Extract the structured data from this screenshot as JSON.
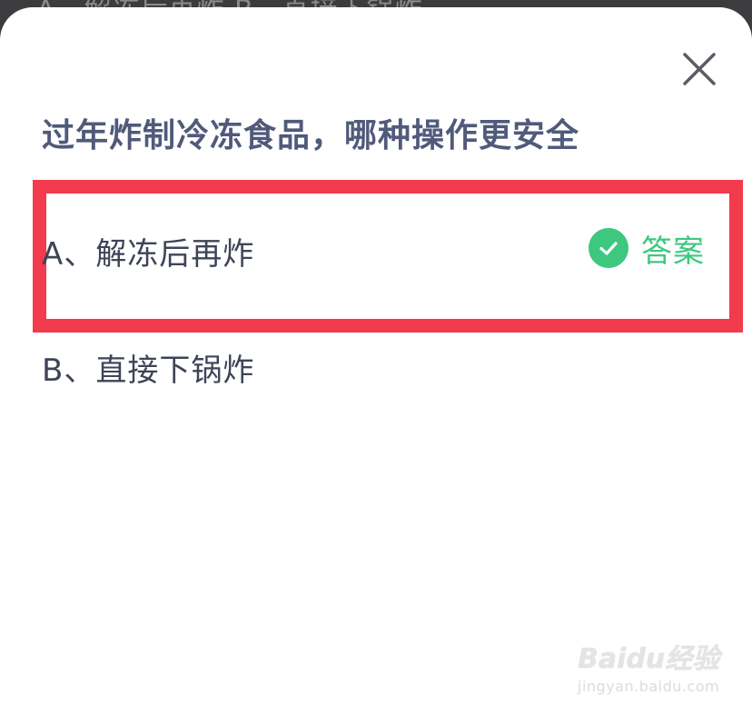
{
  "backdrop": {
    "text": "A、解冻后再炸    B、直接下锅炸"
  },
  "dialog": {
    "question": "过年炸制冷冻食品，哪种操作更安全",
    "options": [
      {
        "label": "A、解冻后再炸",
        "is_answer": true
      },
      {
        "label": "B、直接下锅炸",
        "is_answer": false
      }
    ],
    "answer_label": "答案",
    "close_icon": "close-icon"
  },
  "colors": {
    "question_text": "#505a7a",
    "option_text": "#3e4457",
    "answer_green": "#3ec87f",
    "highlight_red": "#f23b4c",
    "overlay": "#3c3c3e"
  },
  "watermark": {
    "brand": "Baidu经验",
    "url": "jingyan.baidu.com"
  }
}
